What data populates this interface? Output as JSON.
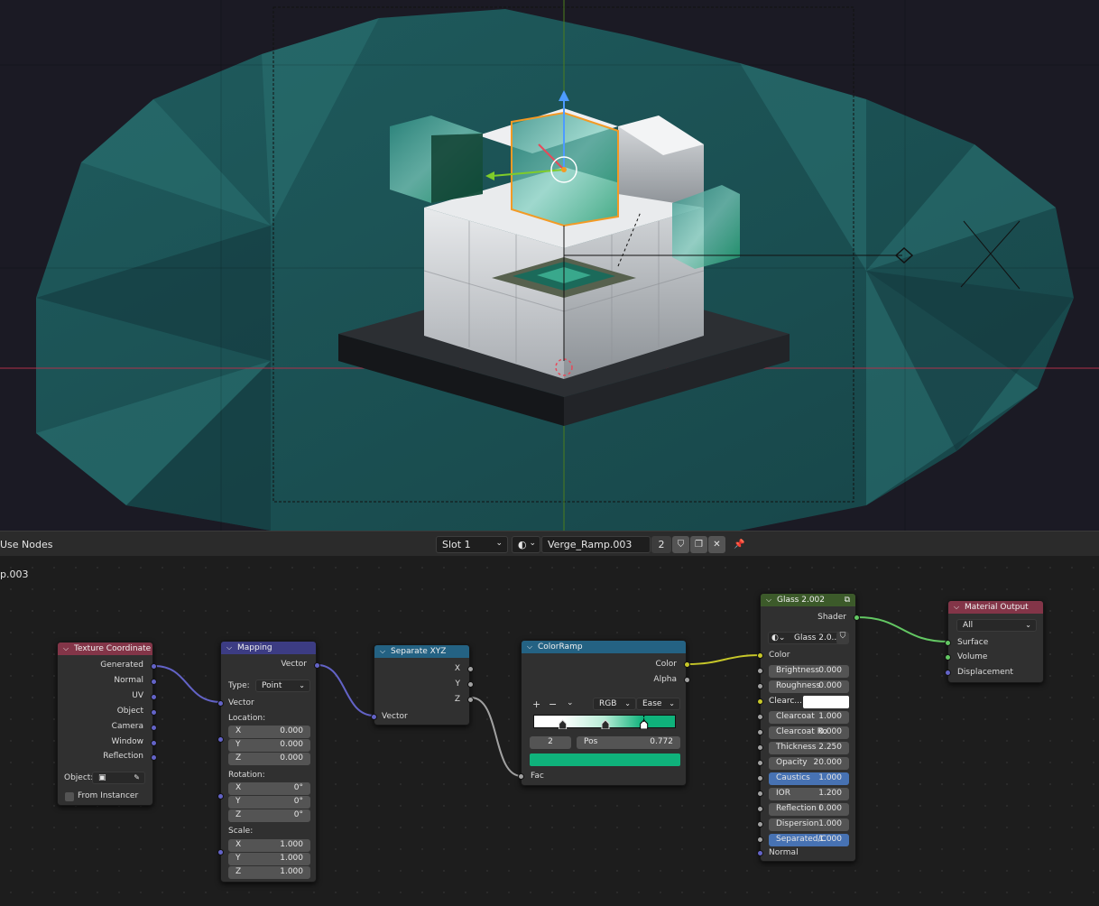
{
  "header": {
    "use_nodes_label": "Use Nodes",
    "slot": "Slot 1",
    "material_name": "Verge_Ramp.003",
    "user_count": "2",
    "breadcrumb_fragment": "p.003",
    "icons": [
      "shading-sphere-icon",
      "fake-user-shield-icon",
      "duplicate-icon",
      "unlink-x-icon",
      "pin-icon"
    ]
  },
  "nodes": {
    "texture_coordinate": {
      "title": "Texture Coordinate",
      "color": "#833548",
      "outputs": [
        "Generated",
        "Normal",
        "UV",
        "Object",
        "Camera",
        "Window",
        "Reflection"
      ],
      "object_label": "Object:",
      "from_instancer": "From Instancer"
    },
    "mapping": {
      "title": "Mapping",
      "color": "#3c3c83",
      "output": "Vector",
      "type_label": "Type:",
      "type_value": "Point",
      "vector_label": "Vector",
      "location_label": "Location:",
      "location": [
        {
          "axis": "X",
          "value": "0.000"
        },
        {
          "axis": "Y",
          "value": "0.000"
        },
        {
          "axis": "Z",
          "value": "0.000"
        }
      ],
      "rotation_label": "Rotation:",
      "rotation": [
        {
          "axis": "X",
          "value": "0°"
        },
        {
          "axis": "Y",
          "value": "0°"
        },
        {
          "axis": "Z",
          "value": "0°"
        }
      ],
      "scale_label": "Scale:",
      "scale": [
        {
          "axis": "X",
          "value": "1.000"
        },
        {
          "axis": "Y",
          "value": "1.000"
        },
        {
          "axis": "Z",
          "value": "1.000"
        }
      ]
    },
    "separate_xyz": {
      "title": "Separate XYZ",
      "color": "#246283",
      "outputs": [
        "X",
        "Y",
        "Z"
      ],
      "input": "Vector"
    },
    "color_ramp": {
      "title": "ColorRamp",
      "color": "#246283",
      "outputs": [
        "Color",
        "Alpha"
      ],
      "plus": "+",
      "minus": "−",
      "mode": "RGB",
      "interpolation": "Ease",
      "stop_index": "2",
      "pos_label": "Pos",
      "pos_value": "0.772",
      "stop_positions": [
        0.2,
        0.5,
        0.77
      ],
      "selected_color": "#0fb27b",
      "input": "Fac"
    },
    "glass": {
      "title": "Glass 2.002",
      "color": "#3c5a2a",
      "output": "Shader",
      "material": "Glass 2.0...",
      "color_label": "Color",
      "params": [
        {
          "label": "Brightness",
          "value": "0.000",
          "highlight": false
        },
        {
          "label": "Roughness",
          "value": "0.000",
          "highlight": false
        },
        {
          "label": "Clearc...",
          "value": "",
          "highlight": false,
          "swatch": "#ffffff"
        },
        {
          "label": "Clearcoat",
          "value": "1.000",
          "highlight": false
        },
        {
          "label": "Clearcoat Ro",
          "value": "0.000",
          "highlight": false
        },
        {
          "label": "Thickness",
          "value": "2.250",
          "highlight": false
        },
        {
          "label": "Opacity",
          "value": "20.000",
          "highlight": false
        },
        {
          "label": "Caustics",
          "value": "1.000",
          "highlight": true
        },
        {
          "label": "IOR",
          "value": "1.200",
          "highlight": false
        },
        {
          "label": "Reflection I",
          "value": "0.000",
          "highlight": false
        },
        {
          "label": "Dispersion",
          "value": "1.000",
          "highlight": false
        },
        {
          "label": "Separated/C",
          "value": "1.000",
          "highlight": true
        }
      ],
      "normal_label": "Normal"
    },
    "material_output": {
      "title": "Material Output",
      "color": "#833548",
      "target": "All",
      "inputs": [
        "Surface",
        "Volume",
        "Displacement"
      ]
    }
  },
  "colors": {
    "link_vector": "#6363c7",
    "link_float": "#a1a1a1",
    "link_color": "#c7c729",
    "link_shader": "#63c763",
    "selection_orange": "#f39a25",
    "accent_teal": "#0fb27b"
  }
}
